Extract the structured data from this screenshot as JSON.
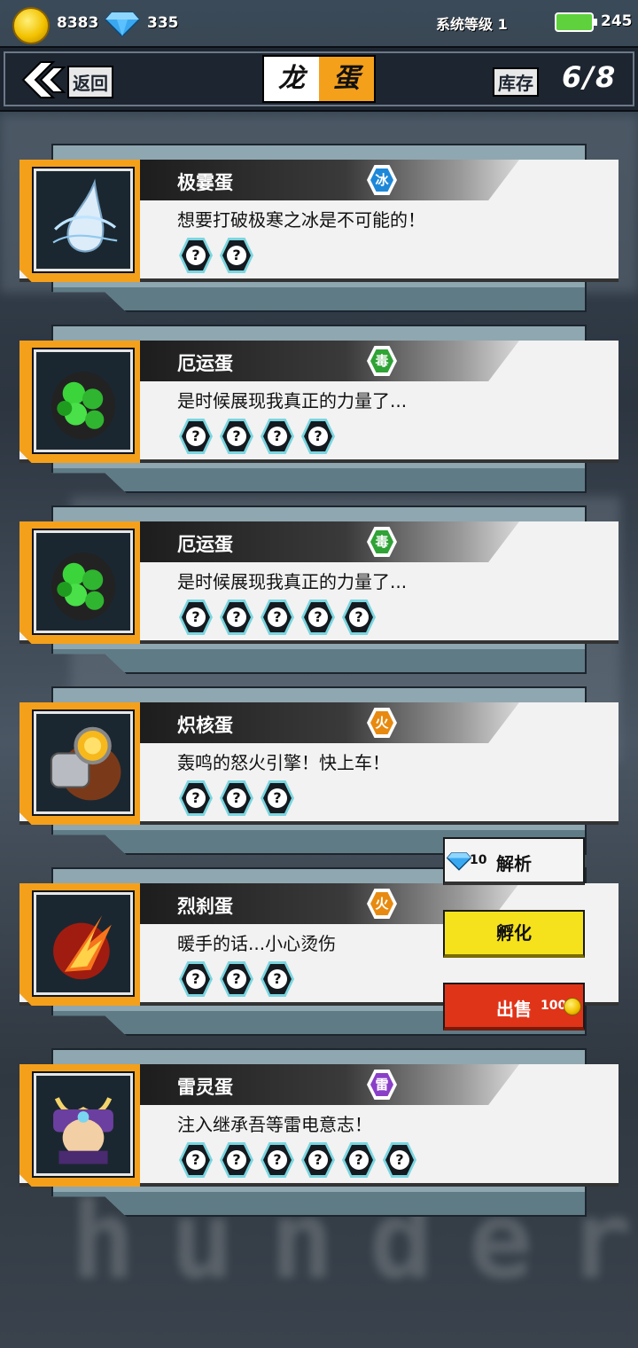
{
  "status": {
    "coins": "8383",
    "gems": "335",
    "system_level": "系统等级 1",
    "energy": "245"
  },
  "header": {
    "back_label": "返回",
    "title_left": "龙",
    "title_right": "蛋",
    "stock_label": "库存",
    "stock_value": "6/8"
  },
  "background_text": "hunder",
  "eggs": [
    {
      "name": "极霎蛋",
      "element": "冰",
      "element_color": "#1e88d8",
      "description": "想要打破极寒之冰是不可能的！",
      "skills": [
        "?",
        "?"
      ],
      "icon": "ice-drop-egg-icon"
    },
    {
      "name": "厄运蛋",
      "element": "毒",
      "element_color": "#2fa335",
      "description": "是时候展现我真正的力量了...",
      "skills": [
        "?",
        "?",
        "?",
        "?"
      ],
      "icon": "toxic-egg-icon"
    },
    {
      "name": "厄运蛋",
      "element": "毒",
      "element_color": "#2fa335",
      "description": "是时候展现我真正的力量了...",
      "skills": [
        "?",
        "?",
        "?",
        "?",
        "?"
      ],
      "icon": "toxic-egg-icon"
    },
    {
      "name": "炽核蛋",
      "element": "火",
      "element_color": "#e88a10",
      "description": "轰鸣的怒火引擎！快上车！",
      "skills": [
        "?",
        "?",
        "?"
      ],
      "icon": "engine-egg-icon"
    },
    {
      "name": "烈刹蛋",
      "element": "火",
      "element_color": "#e88a10",
      "description": "暖手的话...小心烫伤",
      "skills": [
        "?",
        "?",
        "?"
      ],
      "icon": "flame-egg-icon"
    },
    {
      "name": "雷灵蛋",
      "element": "雷",
      "element_color": "#8a3fc8",
      "description": "注入继承吾等雷电意志！",
      "skills": [
        "?",
        "?",
        "?",
        "?",
        "?",
        "?"
      ],
      "icon": "samurai-egg-icon"
    }
  ],
  "actions": {
    "analyze_cost": "10",
    "analyze_label": "解析",
    "hatch_label": "孵化",
    "sell_label": "出售",
    "sell_price": "100"
  }
}
